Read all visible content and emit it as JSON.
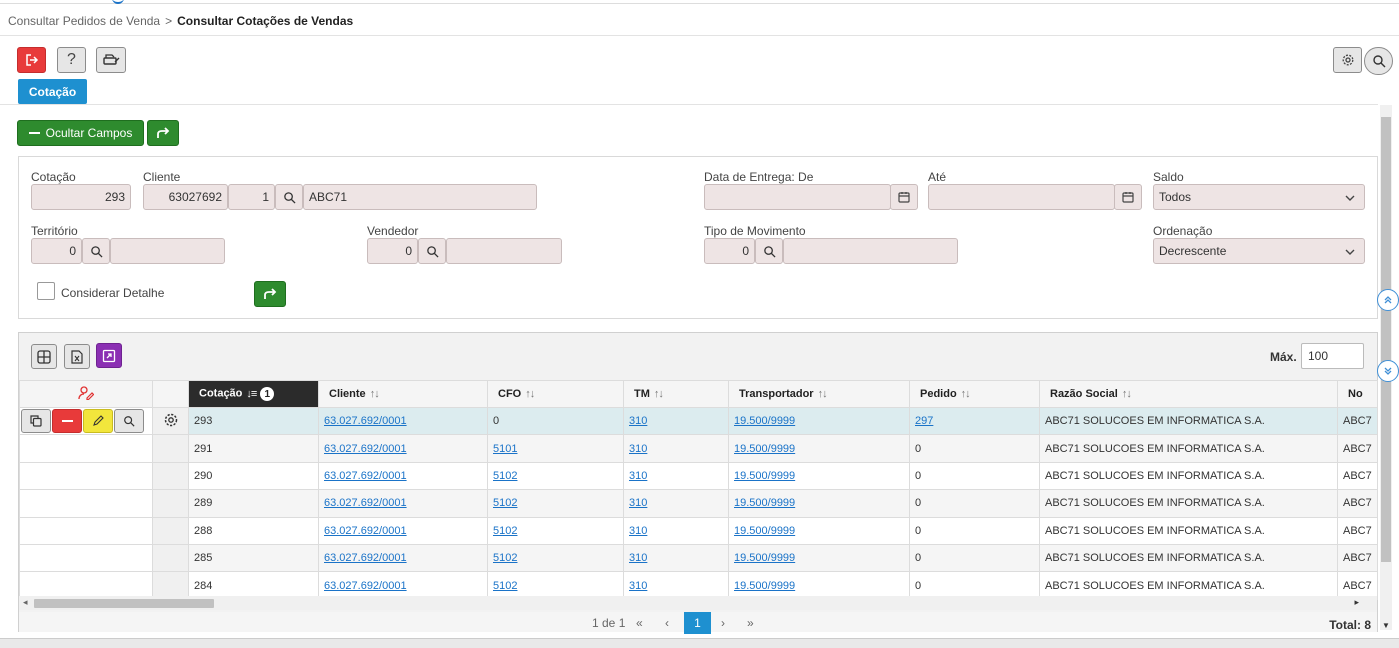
{
  "breadcrumb": {
    "parent": "Consultar Pedidos de Venda",
    "separator": ">",
    "current": "Consultar Cotações de Vendas"
  },
  "toolbar": {
    "exit_icon": "exit-icon",
    "help_label": "?",
    "print_icon": "print-icon",
    "settings_icon": "gear-icon",
    "search_icon": "search-icon"
  },
  "tabs": [
    {
      "label": "Cotação",
      "active": true
    }
  ],
  "filters_bar": {
    "hide_fields_label": "Ocultar Campos"
  },
  "filters": {
    "cotacao": {
      "label": "Cotação",
      "value": "293"
    },
    "cliente": {
      "label": "Cliente",
      "code": "63027692",
      "seq": "1",
      "name": "ABC71"
    },
    "data_entrega_de": {
      "label": "Data de Entrega: De",
      "value": ""
    },
    "ate": {
      "label": "Até",
      "value": ""
    },
    "saldo": {
      "label": "Saldo",
      "value": "Todos"
    },
    "territorio": {
      "label": "Território",
      "code": "0",
      "name": ""
    },
    "vendedor": {
      "label": "Vendedor",
      "code": "0",
      "name": ""
    },
    "tipo_movimento": {
      "label": "Tipo de Movimento",
      "code": "0",
      "name": ""
    },
    "ordenacao": {
      "label": "Ordenação",
      "value": "Decrescente"
    },
    "considerar_detalhe": {
      "label": "Considerar Detalhe",
      "checked": false
    }
  },
  "grid": {
    "max_label": "Máx.",
    "max_value": "100",
    "sort_badge": "1",
    "columns": [
      "Cotação",
      "Cliente",
      "CFO",
      "TM",
      "Transportador",
      "Pedido",
      "Razão Social",
      "No"
    ],
    "rows": [
      {
        "cotacao": "293",
        "cliente": "63.027.692/0001",
        "cfo": "0",
        "tm": "310",
        "transportador": "19.500/9999",
        "pedido": "297",
        "razao": "ABC71 SOLUCOES EM INFORMATICA S.A.",
        "no": "ABC7"
      },
      {
        "cotacao": "291",
        "cliente": "63.027.692/0001",
        "cfo": "5101",
        "tm": "310",
        "transportador": "19.500/9999",
        "pedido": "0",
        "razao": "ABC71 SOLUCOES EM INFORMATICA S.A.",
        "no": "ABC7"
      },
      {
        "cotacao": "290",
        "cliente": "63.027.692/0001",
        "cfo": "5102",
        "tm": "310",
        "transportador": "19.500/9999",
        "pedido": "0",
        "razao": "ABC71 SOLUCOES EM INFORMATICA S.A.",
        "no": "ABC7"
      },
      {
        "cotacao": "289",
        "cliente": "63.027.692/0001",
        "cfo": "5102",
        "tm": "310",
        "transportador": "19.500/9999",
        "pedido": "0",
        "razao": "ABC71 SOLUCOES EM INFORMATICA S.A.",
        "no": "ABC7"
      },
      {
        "cotacao": "288",
        "cliente": "63.027.692/0001",
        "cfo": "5102",
        "tm": "310",
        "transportador": "19.500/9999",
        "pedido": "0",
        "razao": "ABC71 SOLUCOES EM INFORMATICA S.A.",
        "no": "ABC7"
      },
      {
        "cotacao": "285",
        "cliente": "63.027.692/0001",
        "cfo": "5102",
        "tm": "310",
        "transportador": "19.500/9999",
        "pedido": "0",
        "razao": "ABC71 SOLUCOES EM INFORMATICA S.A.",
        "no": "ABC7"
      },
      {
        "cotacao": "284",
        "cliente": "63.027.692/0001",
        "cfo": "5102",
        "tm": "310",
        "transportador": "19.500/9999",
        "pedido": "0",
        "razao": "ABC71 SOLUCOES EM INFORMATICA S.A.",
        "no": "ABC7"
      }
    ]
  },
  "pager": {
    "info": "1 de 1",
    "first": "«",
    "prev": "‹",
    "current": "1",
    "next": "›",
    "last": "»",
    "total": "Total: 8"
  },
  "colors": {
    "accent": "#1e90d0",
    "danger": "#e83a3a",
    "success": "#2e8b2e",
    "purple": "#8b2fb3",
    "warning": "#f2e63c"
  }
}
